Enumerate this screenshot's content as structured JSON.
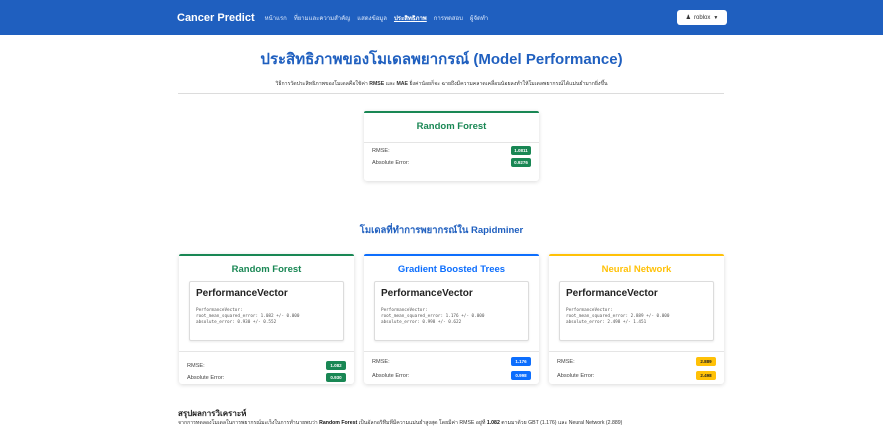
{
  "nav": {
    "brand": "Cancer Predict",
    "links": [
      "หน้าแรก",
      "ที่ยามและความสำคัญ",
      "แสดงข้อมูล",
      "ประสิทธิภาพ",
      "การทดสอบ",
      "ผู้จัดทำ"
    ],
    "active_index": 3,
    "user_label": "roblox",
    "user_icon": "user-icon"
  },
  "page": {
    "title": "ประสิทธิภาพของโมเดลพยากรณ์ (Model Performance)",
    "description_prefix": "วิธีการวัดประสิทธิภาพของโมเดลคือใช้ค่า",
    "description_rmse": "RMSE",
    "description_and": "และ",
    "description_mae": "MAE",
    "description_suffix": "ยิ่งค่าน้อยก็จะ ฉายถึงมีความคลาดเคลื่อนน้อยลงทำให้โมเดลพยากรณ์ได้แม่นยำมากยิ่งขึ้น"
  },
  "top_card": {
    "title": "Random Forest",
    "rmse_label": "RMSE:",
    "rmse_value": "1.0811",
    "ae_label": "Absolute Error:",
    "ae_value": "0.9276"
  },
  "rapidminer_title": "โมเดลที่ทำการพยากรณ์ใน Rapidminer",
  "model_cards": [
    {
      "title": "Random Forest",
      "pv_title": "PerformanceVector",
      "pv_line1": "PerformanceVector:",
      "pv_line2": "root_mean_squared_error: 1.082 +/- 0.000",
      "pv_line3": "absolute_error: 0.930 +/- 0.552",
      "rmse_label": "RMSE:",
      "rmse_value": "1.082",
      "ae_label": "Absolute Error:",
      "ae_value": "0.930",
      "color": "#198754"
    },
    {
      "title": "Gradient Boosted Trees",
      "pv_title": "PerformanceVector",
      "pv_line1": "PerformanceVector:",
      "pv_line2": "root_mean_squared_error: 1.176 +/- 0.000",
      "pv_line3": "absolute_error: 0.998 +/- 0.622",
      "rmse_label": "RMSE:",
      "rmse_value": "1.176",
      "ae_label": "Absolute Error:",
      "ae_value": "0.998",
      "color": "#0d6efd"
    },
    {
      "title": "Neural Network",
      "pv_title": "PerformanceVector",
      "pv_line1": "PerformanceVector:",
      "pv_line2": "root_mean_squared_error: 2.889 +/- 0.000",
      "pv_line3": "absolute_error: 2.498 +/- 1.451",
      "rmse_label": "RMSE:",
      "rmse_value": "2.889",
      "ae_label": "Absolute Error:",
      "ae_value": "2.498",
      "color": "#ffc107"
    }
  ],
  "summary": {
    "heading": "สรุปผลการวิเคราะห์",
    "text_prefix": "จากการทดลองโมเดลในการพยากรณ์มะเร็งในการทำนายพบว่า",
    "text_model": "Random Forest",
    "text_mid": "เป็นอัลกอริทึมที่มีความแม่นยำสูงสุด โดยมีค่า RMSE อยู่ที่",
    "text_value": "1.082",
    "text_suffix": "ตามมาด้วย GBT (1.176) และ Neural Network (2.889)"
  }
}
